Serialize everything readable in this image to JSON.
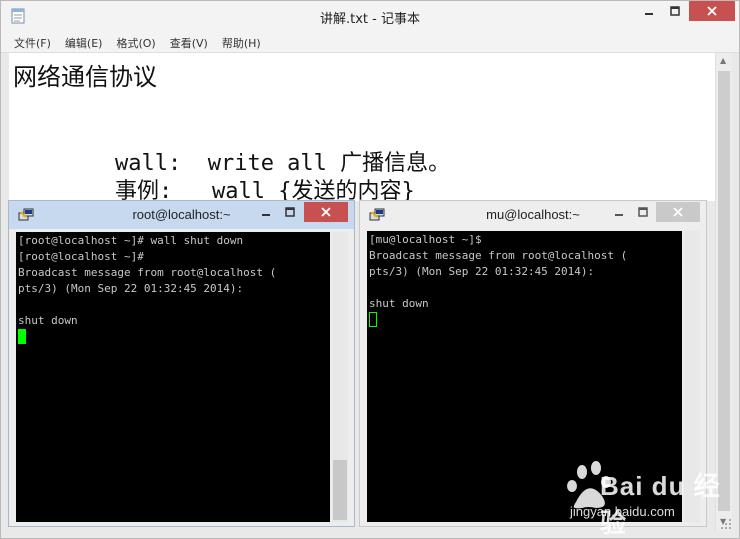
{
  "notepad": {
    "title": "讲解.txt - 记事本",
    "menu": [
      "文件(F)",
      "编辑(E)",
      "格式(O)",
      "查看(V)",
      "帮助(H)"
    ],
    "content": {
      "line1": "网络通信协议",
      "line2": "wall:  write all 广播信息。",
      "line3": "事例:   wall {发送的内容}"
    }
  },
  "terminal_left": {
    "title": "root@localhost:~",
    "lines": [
      "[root@localhost ~]# wall shut down",
      "[root@localhost ~]#",
      "Broadcast message from root@localhost (",
      "pts/3) (Mon Sep 22 01:32:45 2014):",
      "",
      "shut down"
    ]
  },
  "terminal_right": {
    "title": "mu@localhost:~",
    "lines": [
      "[mu@localhost ~]$",
      "Broadcast message from root@localhost (",
      "pts/3) (Mon Sep 22 01:32:45 2014):",
      "",
      "shut down"
    ]
  },
  "watermark": {
    "brand": "Bai du 经验",
    "url": "jingyan.baidu.com"
  },
  "colors": {
    "terminal_bg": "#000000",
    "terminal_fg": "#c8c8c8",
    "cursor": "#00ff00",
    "close_red": "#c75050",
    "active_title": "#c6d9ef"
  }
}
